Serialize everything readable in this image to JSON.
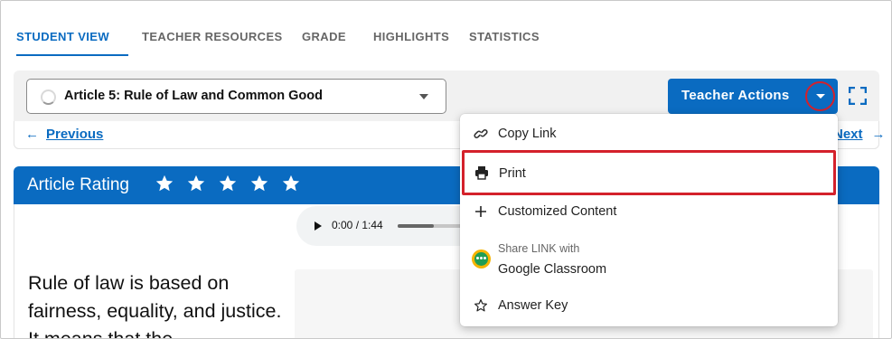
{
  "tabs": [
    {
      "label": "STUDENT VIEW",
      "active": true
    },
    {
      "label": "TEACHER RESOURCES",
      "active": false
    },
    {
      "label": "GRADE",
      "active": false
    },
    {
      "label": "HIGHLIGHTS",
      "active": false
    },
    {
      "label": "STATISTICS",
      "active": false
    }
  ],
  "article_selector": {
    "value": "Article 5: Rule of Law and Common Good"
  },
  "nav": {
    "previous": "Previous",
    "next": "Next"
  },
  "teacher_actions": {
    "label": "Teacher Actions"
  },
  "rating": {
    "label": "Article Rating",
    "stars": 5
  },
  "audio": {
    "time": "0:00 / 1:44",
    "progress": 0.25
  },
  "body": {
    "text": "Rule of law is based on fairness, equality, and justice. It means that the"
  },
  "menu": {
    "copy_link": "Copy Link",
    "print": "Print",
    "customized_content": "Customized Content",
    "share_caption": "Share LINK with",
    "google_classroom": "Google Classroom",
    "answer_key": "Answer Key"
  },
  "colors": {
    "accent": "#0a6bc1",
    "highlight": "#d4212b"
  }
}
